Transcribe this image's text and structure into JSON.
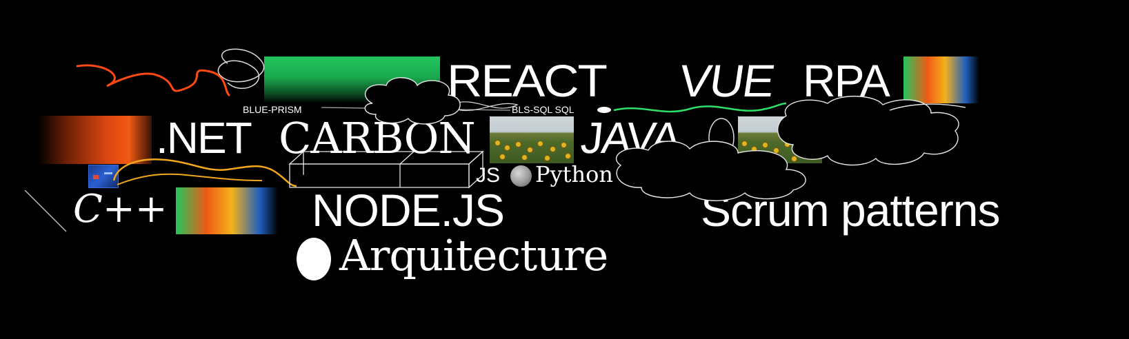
{
  "words": {
    "react": "REACT",
    "vue": "VUE",
    "rpa": "RPA",
    "blue_prism": "BLUE-PRISM",
    "bls_sql": "BLS-SQL SQL",
    "dotnet": ".NET",
    "carbon": "CARBON",
    "java": "JAVA",
    "js": "JS",
    "python": "Python",
    "cpp": "C++",
    "nodejs": "NODE.JS",
    "scrum": "Scrum patterns",
    "arquitecture": "Arquitecture"
  },
  "colors": {
    "background": "#000000",
    "text": "#ffffff",
    "green": "#22c55e",
    "orange": "#ea4f12",
    "squiggle_red": "#ff4a12",
    "squiggle_green": "#2ee06a",
    "squiggle_yellow": "#f2a81c",
    "spectrum": [
      "#22c55e",
      "#f05a14",
      "#f2b21c",
      "#1f5fbf"
    ]
  },
  "images": {
    "sunflower_field_icon": "sunflower-field-photo",
    "moon_icon": "moon-icon",
    "screenshot_thumb_icon": "screen-thumbnail-icon"
  }
}
